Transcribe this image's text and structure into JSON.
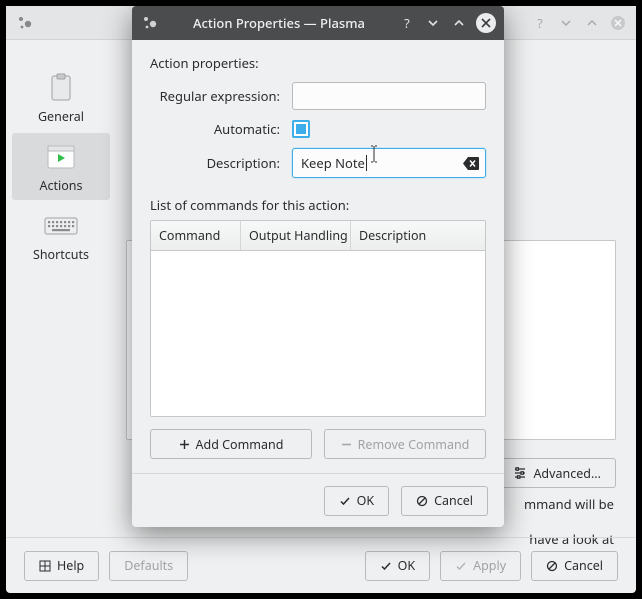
{
  "bg_titlebar": {
    "help_icon": "?",
    "down_icon": "v",
    "up_icon": "^",
    "close_icon": "x"
  },
  "sidebar": {
    "items": [
      {
        "label": "General"
      },
      {
        "label": "Actions"
      },
      {
        "label": "Shortcuts"
      }
    ]
  },
  "bg_buttons": {
    "advanced": "Advanced...",
    "help": "Help",
    "defaults": "Defaults",
    "ok": "OK",
    "apply": "Apply",
    "cancel": "Cancel"
  },
  "bg_hint1": "mmand will be",
  "bg_hint2": "have a look at",
  "dialog": {
    "title": "Action Properties — Plasma",
    "header": "Action properties:",
    "regex_label": "Regular expression:",
    "regex_value": "",
    "automatic_label": "Automatic:",
    "automatic_checked": true,
    "description_label": "Description:",
    "description_value": "Keep Note",
    "list_label": "List of commands for this action:",
    "columns": {
      "command": "Command",
      "output": "Output Handling",
      "description": "Description"
    },
    "add_command": "Add Command",
    "remove_command": "Remove Command",
    "ok": "OK",
    "cancel": "Cancel"
  }
}
